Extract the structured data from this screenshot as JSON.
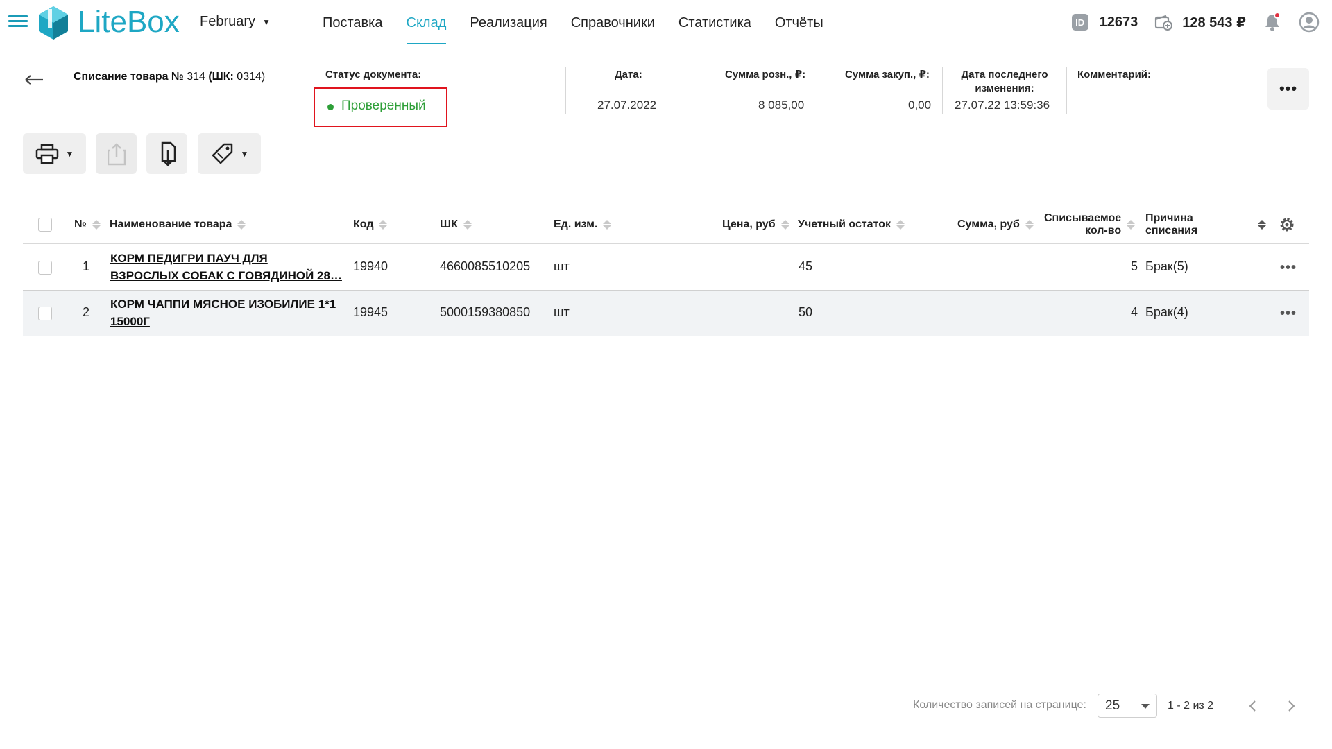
{
  "header": {
    "logo_text": "LiteBox",
    "store": "February",
    "nav": [
      "Поставка",
      "Склад",
      "Реализация",
      "Справочники",
      "Статистика",
      "Отчёты"
    ],
    "active_nav": "Склад",
    "id_icon_text": "ID",
    "account_id": "12673",
    "balance": "128 543 ₽",
    "icons": [
      "menu-icon",
      "id-icon",
      "wallet-icon",
      "bell-icon",
      "avatar-icon"
    ]
  },
  "document": {
    "title_prefix": "Списание товара №",
    "title_num": " 314",
    "title_bk": " (ШК:",
    "title_code": " 0314)",
    "status_label": "Статус документа:",
    "status_value": "Проверенный",
    "date_label": "Дата:",
    "date_value": "27.07.2022",
    "retail_label": "Сумма розн., ₽:",
    "retail_value": "8 085,00",
    "purchase_label": "Сумма закуп., ₽:",
    "purchase_value": "0,00",
    "modified_label_1": "Дата последнего",
    "modified_label_2": "изменения:",
    "modified_value": "27.07.22 13:59:36",
    "comment_label": "Комментарий:",
    "more_label": "•••"
  },
  "toolbar": {
    "buttons": [
      "print-icon",
      "export-icon",
      "import-icon",
      "tag-icon"
    ]
  },
  "table": {
    "columns": {
      "num": "№",
      "name": "Наименование товара",
      "code": "Код",
      "barcode": "ШК",
      "unit": "Ед. изм.",
      "price": "Цена, руб",
      "stock": "Учетный остаток",
      "sum": "Сумма, руб",
      "qty_1": "Списываемое",
      "qty_2": "кол-во",
      "reason_1": "Причина",
      "reason_2": "списания"
    },
    "rows": [
      {
        "num": "1",
        "name_1": "КОРМ ПЕДИГРИ ПАУЧ ДЛЯ",
        "name_2": "ВЗРОСЛЫХ СОБАК С ГОВЯДИНОЙ 28…",
        "code": "19940",
        "barcode": "4660085510205",
        "unit": "шт",
        "price": "",
        "stock": "45",
        "sum": "",
        "qty": "5",
        "reason": "Брак(5)"
      },
      {
        "num": "2",
        "name_1": "КОРМ ЧАППИ МЯСНОЕ ИЗОБИЛИЕ 1*1",
        "name_2": "15000Г",
        "code": "19945",
        "barcode": "5000159380850",
        "unit": "шт",
        "price": "",
        "stock": "50",
        "sum": "",
        "qty": "4",
        "reason": "Брак(4)"
      }
    ],
    "row_more": "•••"
  },
  "pagination": {
    "label": "Количество записей на странице:",
    "per_page": "25",
    "range": "1 - 2 из 2"
  },
  "colors": {
    "accent": "#1ea7c4",
    "status_green": "#2e9f38",
    "highlight_red": "#e0141e"
  }
}
